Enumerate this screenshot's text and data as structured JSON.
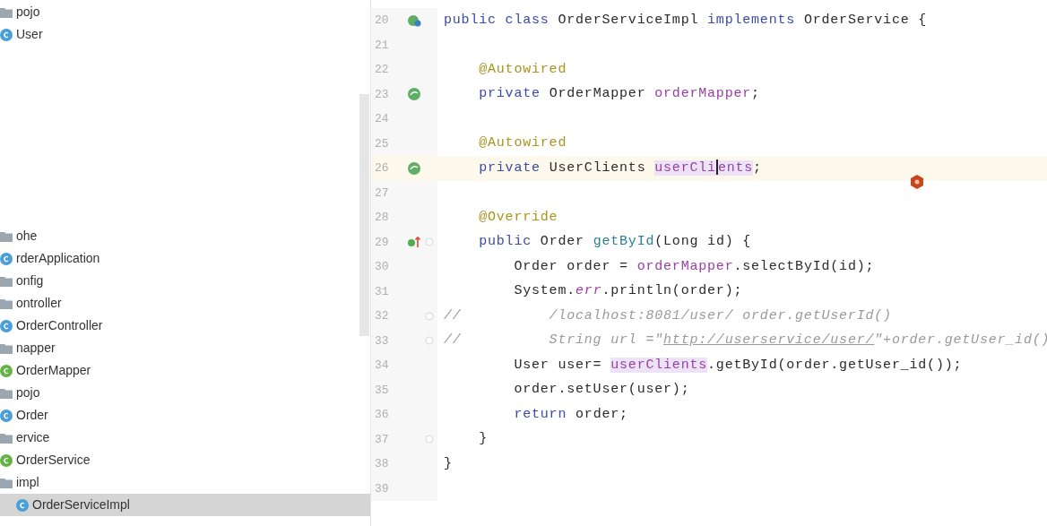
{
  "project_tree": [
    {
      "nodes": [
        {
          "label": "pojo",
          "kind": "folder",
          "selected": false,
          "children": [
            {
              "label": "User",
              "kind": "class",
              "selected": false
            }
          ]
        }
      ]
    },
    {
      "nodes": [
        {
          "label": "ohe",
          "kind": "package",
          "selected": false
        },
        {
          "label": "rderApplication",
          "kind": "class",
          "selected": false
        },
        {
          "label": "onfig",
          "kind": "package",
          "selected": false
        },
        {
          "label": "ontroller",
          "kind": "package",
          "selected": false,
          "children": [
            {
              "label": "OrderController",
              "kind": "class",
              "selected": false
            }
          ]
        },
        {
          "label": "napper",
          "kind": "package",
          "selected": false,
          "children": [
            {
              "label": "OrderMapper",
              "kind": "interface",
              "selected": false
            }
          ]
        },
        {
          "label": "pojo",
          "kind": "package",
          "selected": false,
          "children": [
            {
              "label": "Order",
              "kind": "class",
              "selected": false
            }
          ]
        },
        {
          "label": "ervice",
          "kind": "package",
          "selected": false,
          "children": [
            {
              "label": "OrderService",
              "kind": "interface",
              "selected": false
            },
            {
              "label": "impl",
              "kind": "folder",
              "selected": false,
              "children": [
                {
                  "label": "OrderServiceImpl",
                  "kind": "class",
                  "selected": true
                }
              ]
            }
          ]
        }
      ]
    }
  ],
  "editor": {
    "lines": [
      {
        "number": "20",
        "gutter_icon": {
          "kind": "implements"
        },
        "fold": false,
        "current": false,
        "tokens": [
          {
            "text": "public class ",
            "kind": "keyword"
          },
          {
            "text": "OrderServiceImpl ",
            "kind": "plain"
          },
          {
            "text": "implements ",
            "kind": "keyword"
          },
          {
            "text": "OrderService {",
            "kind": "plain"
          }
        ]
      },
      {
        "number": "21",
        "fold": false,
        "current": false
      },
      {
        "number": "22",
        "fold": false,
        "current": false,
        "tokens": [
          {
            "text": "    @Autowired",
            "kind": "annotation"
          }
        ]
      },
      {
        "number": "23",
        "gutter_icon": {
          "kind": "bean"
        },
        "fold": false,
        "current": false,
        "tokens": [
          {
            "text": "    private ",
            "kind": "keyword"
          },
          {
            "text": "OrderMapper ",
            "kind": "plain"
          },
          {
            "text": "orderMapper",
            "kind": "field"
          },
          {
            "text": ";",
            "kind": "plain"
          }
        ]
      },
      {
        "number": "24",
        "fold": false,
        "current": false
      },
      {
        "number": "25",
        "fold": false,
        "current": false,
        "tokens": [
          {
            "text": "    @Autowired",
            "kind": "annotation"
          }
        ]
      },
      {
        "number": "26",
        "gutter_icon": {
          "kind": "bean"
        },
        "fold": false,
        "current": true,
        "tokens": [
          {
            "text": "    private ",
            "kind": "keyword"
          },
          {
            "text": "UserClients ",
            "kind": "plain"
          },
          {
            "text": "userCli",
            "kind": "field_highlight",
            "caret_after": true
          },
          {
            "text": "ents",
            "kind": "field_highlight"
          },
          {
            "text": ";",
            "kind": "plain"
          }
        ]
      },
      {
        "number": "27",
        "fold": false,
        "current": false
      },
      {
        "number": "28",
        "fold": false,
        "current": false,
        "tokens": [
          {
            "text": "    @Override",
            "kind": "annotation"
          }
        ]
      },
      {
        "number": "29",
        "gutter_icon": {
          "kind": "override"
        },
        "fold": true,
        "current": false,
        "tokens": [
          {
            "text": "    public ",
            "kind": "keyword"
          },
          {
            "text": "Order ",
            "kind": "plain"
          },
          {
            "text": "getById",
            "kind": "method"
          },
          {
            "text": "(Long id) {",
            "kind": "plain"
          }
        ]
      },
      {
        "number": "30",
        "fold": false,
        "current": false,
        "tokens": [
          {
            "text": "        Order order = ",
            "kind": "plain"
          },
          {
            "text": "orderMapper",
            "kind": "field"
          },
          {
            "text": ".selectById(id);",
            "kind": "plain"
          }
        ]
      },
      {
        "number": "31",
        "fold": false,
        "current": false,
        "tokens": [
          {
            "text": "        System.",
            "kind": "plain"
          },
          {
            "text": "err",
            "kind": "static_field"
          },
          {
            "text": ".println(order);",
            "kind": "plain"
          }
        ]
      },
      {
        "number": "32",
        "fold": true,
        "current": false,
        "tokens": [
          {
            "text": "//          /localhost:8081/user/ order.getUserId()",
            "kind": "comment"
          }
        ]
      },
      {
        "number": "33",
        "fold": true,
        "current": false,
        "tokens": [
          {
            "text": "//          String url =\"",
            "kind": "comment"
          },
          {
            "text": "http://userservice/user/",
            "kind": "comment_link"
          },
          {
            "text": "\"+order.getUser_id()",
            "kind": "comment"
          }
        ]
      },
      {
        "number": "34",
        "fold": false,
        "current": false,
        "tokens": [
          {
            "text": "        User user= ",
            "kind": "plain"
          },
          {
            "text": "userClients",
            "kind": "field_highlight"
          },
          {
            "text": ".getById(order.getUser_id());",
            "kind": "plain"
          }
        ]
      },
      {
        "number": "35",
        "fold": false,
        "current": false,
        "tokens": [
          {
            "text": "        order.setUser(user);",
            "kind": "plain"
          }
        ]
      },
      {
        "number": "36",
        "fold": false,
        "current": false,
        "tokens": [
          {
            "text": "        return ",
            "kind": "keyword"
          },
          {
            "text": "order;",
            "kind": "plain"
          }
        ]
      },
      {
        "number": "37",
        "fold": true,
        "current": false,
        "tokens": [
          {
            "text": "    }",
            "kind": "plain"
          }
        ]
      },
      {
        "number": "38",
        "fold": false,
        "current": false,
        "tokens": [
          {
            "text": "}",
            "kind": "plain"
          }
        ]
      },
      {
        "number": "39",
        "fold": false,
        "current": false
      }
    ]
  }
}
